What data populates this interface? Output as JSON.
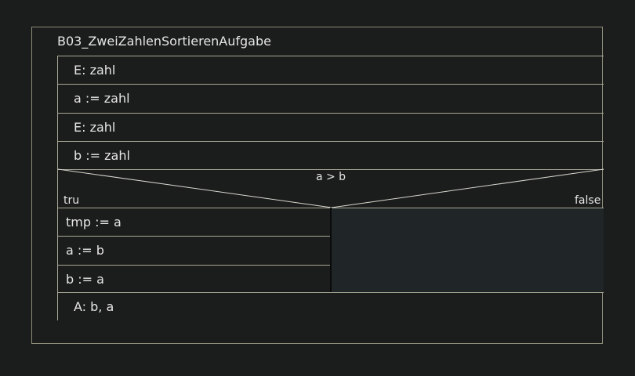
{
  "diagram": {
    "title": "B03_ZweiZahlenSortierenAufgabe",
    "statements_before": [
      "E: zahl",
      "a := zahl",
      "E: zahl",
      "b := zahl"
    ],
    "condition": {
      "text": "a > b",
      "true_label": "tru",
      "false_label": "false",
      "true_branch": [
        "tmp := a",
        "a := b",
        "b := a"
      ],
      "false_branch": []
    },
    "statements_after": [
      "A: b, a"
    ]
  }
}
